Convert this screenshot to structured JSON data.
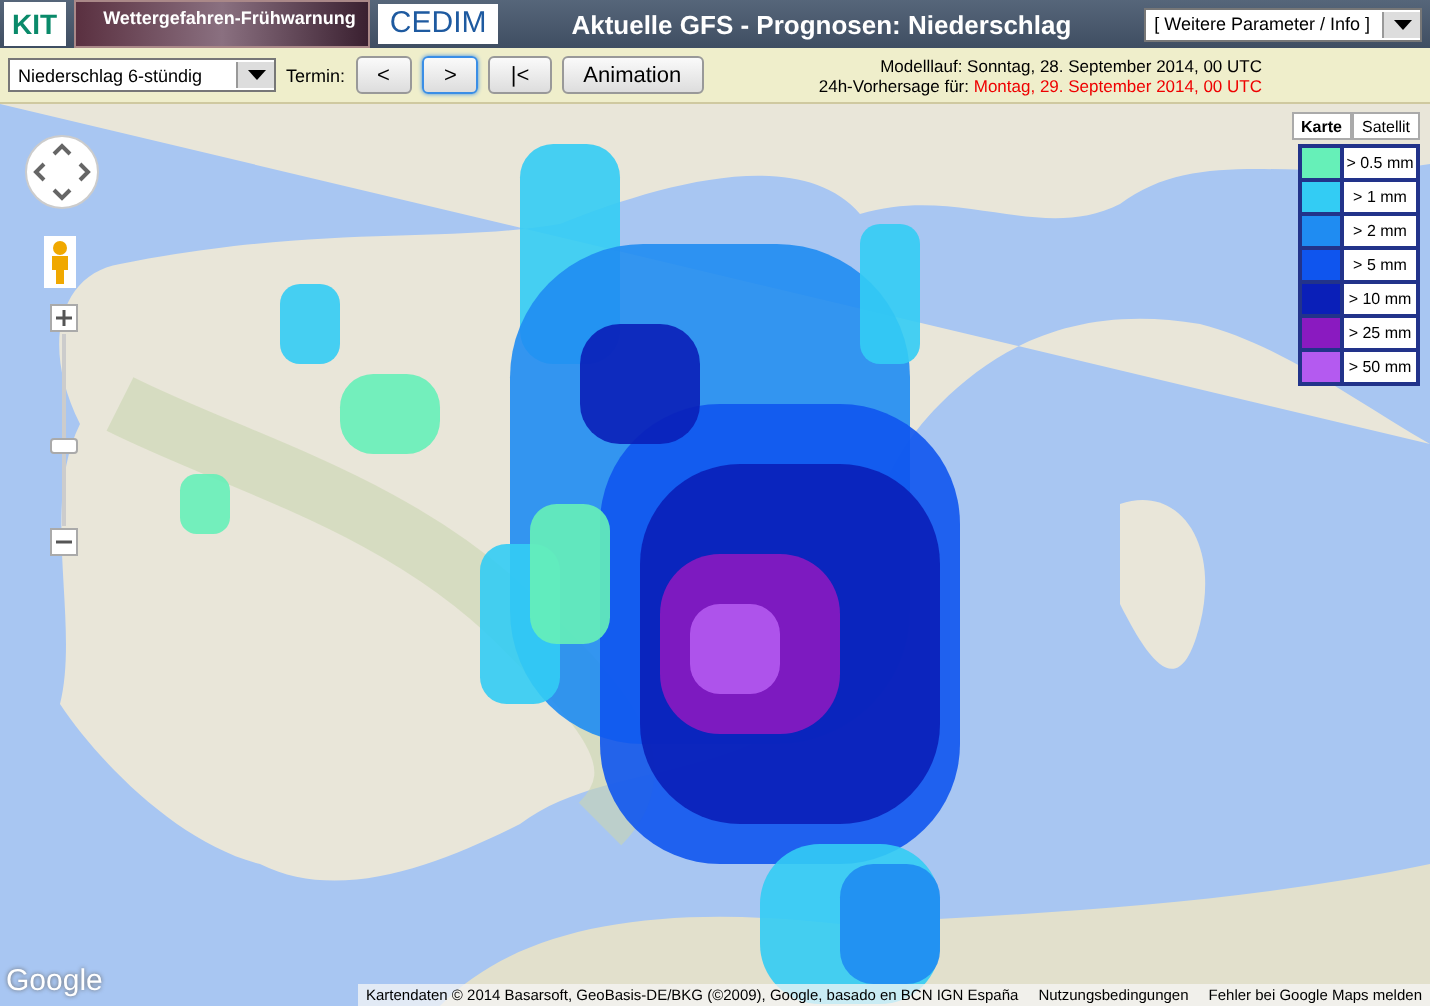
{
  "header": {
    "logos": [
      "KIT",
      "Wettergefahren-Frühwarnung",
      "CEDIM"
    ],
    "title": "Aktuelle GFS - Prognosen: Niederschlag",
    "menu": "[ Weitere Parameter / Info ]"
  },
  "toolbar": {
    "product": "Niederschlag 6-stündig",
    "termin_label": "Termin:",
    "buttons": [
      {
        "label": "<",
        "selected": false
      },
      {
        "label": ">",
        "selected": true
      },
      {
        "label": "|<",
        "selected": false
      },
      {
        "label": "Animation",
        "selected": false
      }
    ],
    "model_run": "Modelllauf: Sonntag, 28. September 2014, 00 UTC",
    "forecast_label": "24h-Vorhersage für:",
    "forecast_time": "Montag, 29. September 2014, 00 UTC"
  },
  "map": {
    "map_types": [
      {
        "label": "Karte",
        "selected": true
      },
      {
        "label": "Satellit",
        "selected": false
      }
    ],
    "zoom": {
      "level": 0.41
    },
    "legend": [
      {
        "label": "> 0.5 mm",
        "color": "#66f0b8"
      },
      {
        "label": "> 1 mm",
        "color": "#33ccf4"
      },
      {
        "label": "> 2 mm",
        "color": "#1f8cf2"
      },
      {
        "label": "> 5 mm",
        "color": "#0f55ee"
      },
      {
        "label": "> 10 mm",
        "color": "#0a1fb8"
      },
      {
        "label": "> 25 mm",
        "color": "#8a1ac0"
      },
      {
        "label": "> 50 mm",
        "color": "#b45af0"
      }
    ],
    "google": "Google",
    "attribution": [
      "Kartendaten © 2014 Basarsoft, GeoBasis-DE/BKG (©2009), Google, basado en BCN IGN España",
      "Nutzungsbedingungen",
      "Fehler bei Google Maps melden"
    ]
  }
}
